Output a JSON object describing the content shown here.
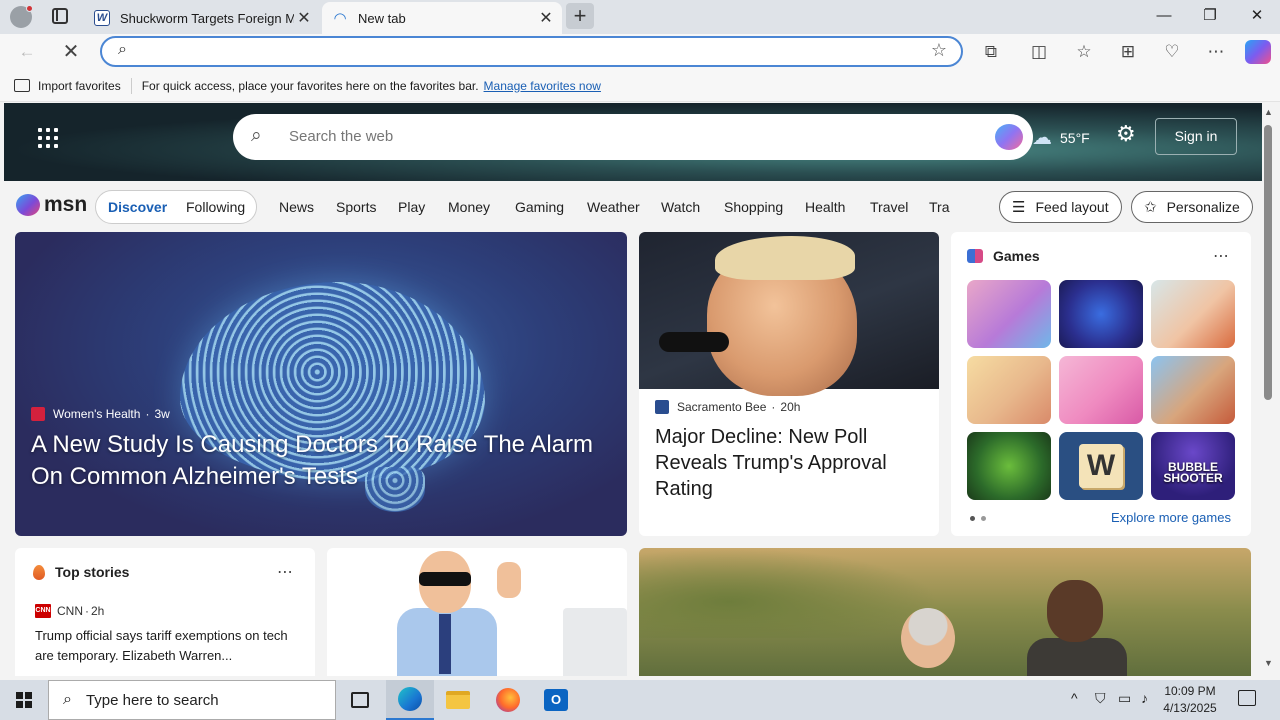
{
  "browser": {
    "tabs": [
      {
        "title": "Shuckworm Targets Foreign Milit",
        "favicon": "w-icon"
      },
      {
        "title": "New tab",
        "favicon": "edge-loading-icon"
      }
    ],
    "newtab_symbol": "+",
    "window_controls": [
      "—",
      "❐",
      "✕"
    ],
    "omnibox_value": "",
    "favorites_bar": {
      "import_label": "Import favorites",
      "hint": "For quick access, place your favorites here on the favorites bar.",
      "manage_link": "Manage favorites now"
    }
  },
  "msn": {
    "search_placeholder": "Search the web",
    "weather": {
      "temp": "55°F"
    },
    "sign_in": "Sign in",
    "logo_text": "msn",
    "pill_tabs": [
      "Discover",
      "Following"
    ],
    "nav": [
      "News",
      "Sports",
      "Play",
      "Money",
      "Gaming",
      "Weather",
      "Watch",
      "Shopping",
      "Health",
      "Travel",
      "Tra"
    ],
    "feed_layout": "Feed layout",
    "personalize": "Personalize",
    "hero": {
      "source": "Women's Health",
      "age": "3w",
      "title": "A New Study Is Causing Doctors To Raise The Alarm On Common Alzheimer's Tests"
    },
    "trump_card": {
      "source": "Sacramento Bee",
      "age": "20h",
      "title": "Major Decline: New Poll Reveals Trump's Approval Rating"
    },
    "games": {
      "title": "Games",
      "tiles": [
        {
          "name": "makeup-game",
          "label": ""
        },
        {
          "name": "jewel-match-game",
          "label": ""
        },
        {
          "name": "hospital-game",
          "label": ""
        },
        {
          "name": "dress-up-game",
          "label": ""
        },
        {
          "name": "fashion-game",
          "label": ""
        },
        {
          "name": "restaurant-game",
          "label": ""
        },
        {
          "name": "gems-game",
          "label": ""
        },
        {
          "name": "words-game",
          "label": "W"
        },
        {
          "name": "bubble-shooter-game",
          "label": "BUBBLE SHOOTER"
        }
      ],
      "explore": "Explore more games"
    },
    "top_stories": {
      "title": "Top stories",
      "source": "CNN",
      "age": "2h",
      "headline": "Trump official says tariff exemptions on tech are temporary. Elizabeth Warren..."
    }
  },
  "taskbar": {
    "search_placeholder": "Type here to search",
    "time": "10:09 PM",
    "date": "4/13/2025"
  }
}
